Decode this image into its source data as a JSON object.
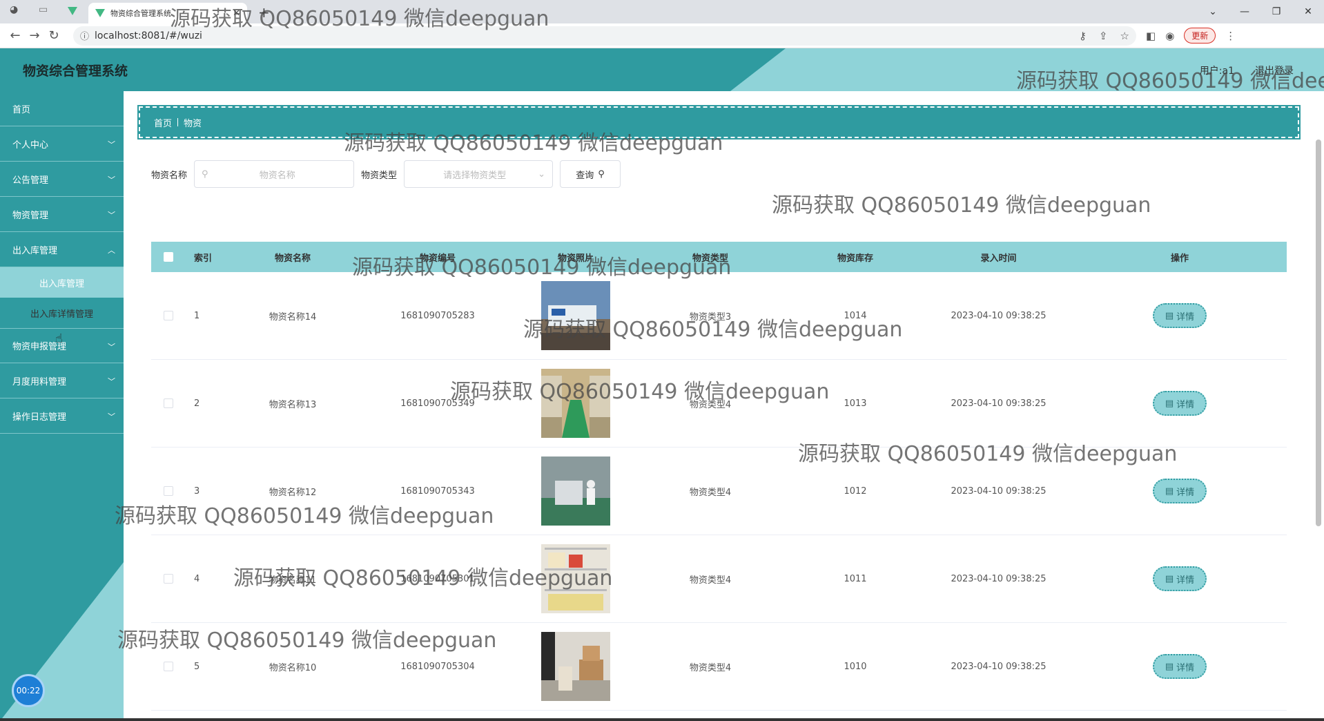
{
  "browser": {
    "tab_title": "物资综合管理系统",
    "url": "localhost:8081/#/wuzi",
    "update_label": "更新"
  },
  "header": {
    "title": "物资综合管理系统",
    "user": "用户:a1",
    "logout": "退出登录"
  },
  "sidebar": {
    "items": [
      {
        "label": "首页",
        "has_children": false
      },
      {
        "label": "个人中心",
        "has_children": true
      },
      {
        "label": "公告管理",
        "has_children": true
      },
      {
        "label": "物资管理",
        "has_children": true
      },
      {
        "label": "出入库管理",
        "has_children": true
      }
    ],
    "sub_items": [
      {
        "label": "出入库管理",
        "active": true
      },
      {
        "label": "出入库详情管理",
        "active": false
      }
    ],
    "items_after": [
      {
        "label": "物资申报管理"
      },
      {
        "label": "月度用料管理"
      },
      {
        "label": "操作日志管理"
      }
    ],
    "timer": "00:22"
  },
  "breadcrumb": {
    "home": "首页",
    "current": "物资"
  },
  "search": {
    "name_label": "物资名称",
    "name_placeholder": "物资名称",
    "type_label": "物资类型",
    "type_placeholder": "请选择物资类型",
    "query_label": "查询"
  },
  "table": {
    "headers": {
      "index": "索引",
      "name": "物资名称",
      "code": "物资编号",
      "photo": "物资照片",
      "type": "物资类型",
      "stock": "物资库存",
      "time": "录入时间",
      "op": "操作"
    },
    "rows": [
      {
        "index": "1",
        "name": "物资名称14",
        "code": "1681090705283",
        "type": "物资类型3",
        "stock": "1014",
        "time": "2023-04-10 09:38:25",
        "photo_scene": "truck"
      },
      {
        "index": "2",
        "name": "物资名称13",
        "code": "1681090705349",
        "type": "物资类型4",
        "stock": "1013",
        "time": "2023-04-10 09:38:25",
        "photo_scene": "warehouse"
      },
      {
        "index": "3",
        "name": "物资名称12",
        "code": "1681090705343",
        "type": "物资类型4",
        "stock": "1012",
        "time": "2023-04-10 09:38:25",
        "photo_scene": "workers"
      },
      {
        "index": "4",
        "name": "物资名称11",
        "code": "1681090705301",
        "type": "物资类型4",
        "stock": "1011",
        "time": "2023-04-10 09:38:25",
        "photo_scene": "shelves"
      },
      {
        "index": "5",
        "name": "物资名称10",
        "code": "1681090705304",
        "type": "物资类型4",
        "stock": "1010",
        "time": "2023-04-10 09:38:25",
        "photo_scene": "boxes"
      }
    ],
    "detail_label": "详情"
  },
  "watermark_text": "源码获取 QQ86050149 微信deepguan",
  "colors": {
    "primary": "#2f9ba0",
    "light": "#8fd3d8"
  }
}
